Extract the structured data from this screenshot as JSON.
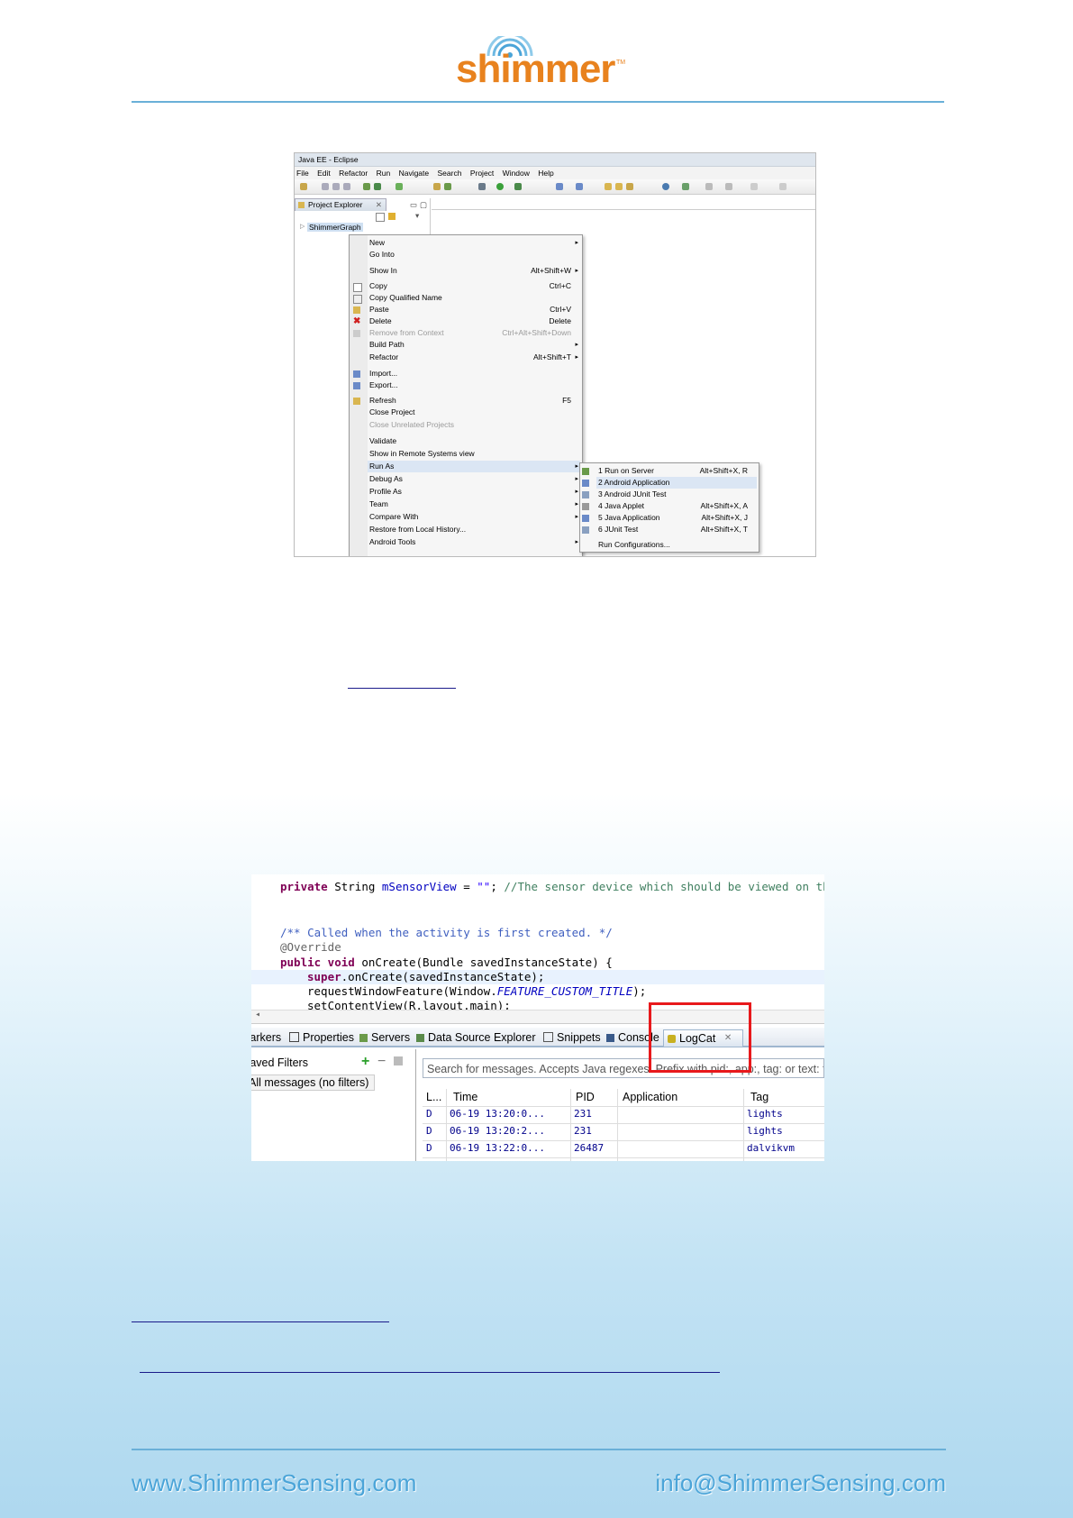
{
  "logo": {
    "text": "shimmer",
    "mark": "TM"
  },
  "eclipse": {
    "window_title": "Java EE - Eclipse",
    "menu": [
      "File",
      "Edit",
      "Refactor",
      "Run",
      "Navigate",
      "Search",
      "Project",
      "Window",
      "Help"
    ],
    "panel_title": "Project Explorer",
    "tree_item": "ShimmerGraph",
    "context_menu": [
      {
        "label": "New",
        "shortcut": "",
        "arrow": true
      },
      {
        "label": "Go Into",
        "shortcut": ""
      },
      {
        "label": "Show In",
        "shortcut": "Alt+Shift+W",
        "arrow": true
      },
      {
        "label": "Copy",
        "shortcut": "Ctrl+C"
      },
      {
        "label": "Copy Qualified Name",
        "shortcut": ""
      },
      {
        "label": "Paste",
        "shortcut": "Ctrl+V"
      },
      {
        "label": "Delete",
        "shortcut": "Delete"
      },
      {
        "label": "Remove from Context",
        "shortcut": "Ctrl+Alt+Shift+Down"
      },
      {
        "label": "Build Path",
        "shortcut": "",
        "arrow": true
      },
      {
        "label": "Refactor",
        "shortcut": "Alt+Shift+T",
        "arrow": true
      },
      {
        "label": "Import...",
        "shortcut": ""
      },
      {
        "label": "Export...",
        "shortcut": ""
      },
      {
        "label": "Refresh",
        "shortcut": "F5"
      },
      {
        "label": "Close Project",
        "shortcut": ""
      },
      {
        "label": "Close Unrelated Projects",
        "shortcut": ""
      },
      {
        "label": "Validate",
        "shortcut": ""
      },
      {
        "label": "Show in Remote Systems view",
        "shortcut": ""
      },
      {
        "label": "Run As",
        "shortcut": "",
        "arrow": true
      },
      {
        "label": "Debug As",
        "shortcut": "",
        "arrow": true
      },
      {
        "label": "Profile As",
        "shortcut": "",
        "arrow": true
      },
      {
        "label": "Team",
        "shortcut": "",
        "arrow": true
      },
      {
        "label": "Compare With",
        "shortcut": "",
        "arrow": true
      },
      {
        "label": "Restore from Local History...",
        "shortcut": ""
      },
      {
        "label": "Android Tools",
        "shortcut": "",
        "arrow": true
      }
    ],
    "submenu": [
      {
        "label": "1 Run on Server",
        "shortcut": "Alt+Shift+X, R"
      },
      {
        "label": "2 Android Application",
        "shortcut": ""
      },
      {
        "label": "3 Android JUnit Test",
        "shortcut": ""
      },
      {
        "label": "4 Java Applet",
        "shortcut": "Alt+Shift+X, A"
      },
      {
        "label": "5 Java Application",
        "shortcut": "Alt+Shift+X, J"
      },
      {
        "label": "6 JUnit Test",
        "shortcut": "Alt+Shift+X, T"
      },
      {
        "label": "Run Configurations...",
        "shortcut": ""
      }
    ]
  },
  "code": {
    "line1_kw": "private",
    "line1_type": " String ",
    "line1_field": "mSensorView",
    "line1_eq": " = ",
    "line1_str": "\"\"",
    "line1_semi": "; ",
    "line1_cmt": "//The sensor device which should be viewed on th",
    "javadoc": "/** Called when the activity is first created. */",
    "annotation": "@Override",
    "sig_kw": "public void",
    "sig_rest": " onCreate(Bundle savedInstanceState) {",
    "super_kw": "super",
    "super_rest": ".onCreate(savedInstanceState);",
    "req_pre": "requestWindowFeature(Window.",
    "req_const": "FEATURE_CUSTOM_TITLE",
    "req_post": ");",
    "partial": "setContentView(R.layout.main);"
  },
  "views": {
    "tabs": [
      "Markers",
      "Properties",
      "Servers",
      "Data Source Explorer",
      "Snippets",
      "Console",
      "LogCat"
    ],
    "saved_filters": "Saved Filters",
    "all_messages": "All messages (no filters)",
    "search_placeholder": "Search for messages. Accepts Java regexes. Prefix with pid:, app:, tag: or text: to limit scope.",
    "columns": [
      "L...",
      "Time",
      "PID",
      "Application",
      "Tag"
    ],
    "rows": [
      {
        "level": "D",
        "time": "06-19 13:20:0...",
        "pid": "231",
        "app": "",
        "tag": "lights"
      },
      {
        "level": "D",
        "time": "06-19 13:20:2...",
        "pid": "231",
        "app": "",
        "tag": "lights"
      },
      {
        "level": "D",
        "time": "06-19 13:22:0...",
        "pid": "26487",
        "app": "",
        "tag": "dalvikvm"
      }
    ]
  },
  "footer": {
    "website": "www.ShimmerSensing.com",
    "email": "info@ShimmerSensing.com"
  },
  "colors": {
    "accent": "#e8821e",
    "footer_text": "#4aa4d8",
    "rule": "#6ab0d8",
    "highlight_box": "#e8191c"
  }
}
